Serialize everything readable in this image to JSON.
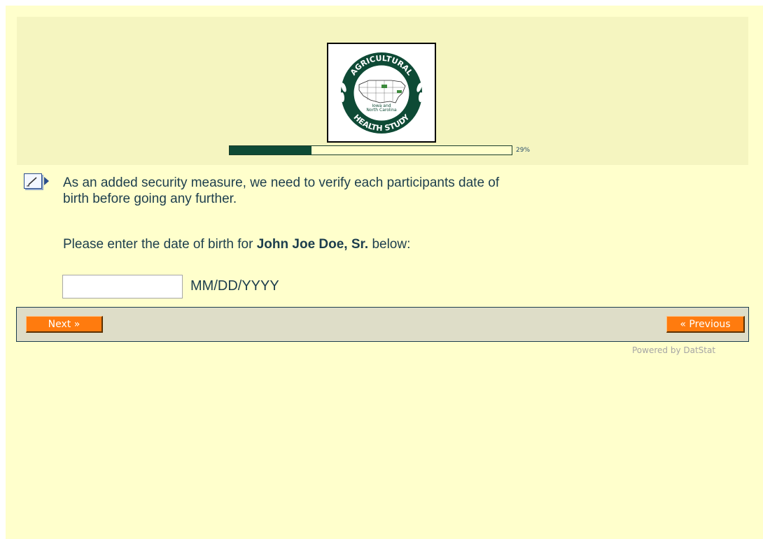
{
  "header": {
    "logo": {
      "top_text": "AGRICULTURAL",
      "bottom_text": "HEALTH STUDY",
      "center_text": "Iowa and North Carolina",
      "center_line1": "Iowa and",
      "center_line2": "North Carolina",
      "colors": {
        "ring": "#0e4a35",
        "highlight": "#3c8a3c"
      }
    },
    "progress": {
      "value": 0.29,
      "label": "29%"
    }
  },
  "question": {
    "line1": "As an added security measure, we need to verify each participants date of",
    "line2": "birth before going any further.",
    "prompt_prefix": "Please enter the date of birth for ",
    "participant_name": "John Joe Doe, Sr.",
    "prompt_suffix": " below:"
  },
  "dob_field": {
    "value": "",
    "format_hint": "MM/DD/YYYY"
  },
  "nav": {
    "next_label": "Next »",
    "previous_label": "« Previous"
  },
  "footer": {
    "powered_by": "Powered by DatStat"
  },
  "colors": {
    "page_bg": "#ffffcc",
    "header_bg": "#f5f5c0",
    "accent": "#ff7b0e",
    "text": "#1c3d4d"
  }
}
